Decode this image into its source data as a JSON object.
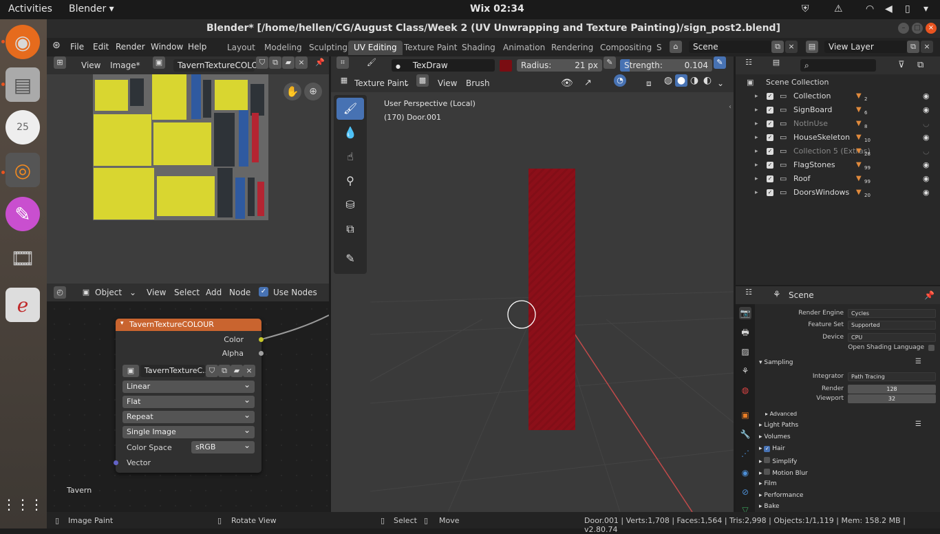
{
  "topbar": {
    "activities": "Activities",
    "app": "Blender ▾",
    "clock": "Wix 02:34"
  },
  "window": {
    "title": "Blender* [/home/hellen/CG/August Class/Week 2 (UV Unwrapping and Texture Painting)/sign_post2.blend]"
  },
  "menu": [
    "File",
    "Edit",
    "Render",
    "Window",
    "Help"
  ],
  "workspaces": [
    "Layout",
    "Modeling",
    "Sculpting",
    "UV Editing",
    "Texture Paint",
    "Shading",
    "Animation",
    "Rendering",
    "Compositing",
    "S"
  ],
  "scene": {
    "name": "Scene",
    "view_layer": "View Layer"
  },
  "image_editor": {
    "view": "View",
    "image": "Image*",
    "image_name": "TavernTextureCOLO..."
  },
  "paint_header": {
    "brush": "TexDraw",
    "radius_label": "Radius:",
    "radius": "21 px",
    "strength_label": "Strength:",
    "strength": "0.104",
    "mode": "Texture Paint",
    "view": "View",
    "brush_menu": "Brush"
  },
  "viewport": {
    "perspective": "User Perspective (Local)",
    "object": "(170) Door.001"
  },
  "node_header": {
    "mode": "Object",
    "view": "View",
    "select": "Select",
    "add": "Add",
    "node": "Node",
    "use_nodes": "Use Nodes"
  },
  "node": {
    "title": "TavernTextureCOLOUR",
    "out_color": "Color",
    "out_alpha": "Alpha",
    "image": "TavernTextureC...",
    "interp": "Linear",
    "proj": "Flat",
    "ext": "Repeat",
    "source": "Single Image",
    "cs_label": "Color Space",
    "cs": "sRGB",
    "vector": "Vector",
    "frame": "Tavern"
  },
  "outliner": {
    "root": "Scene Collection",
    "items": [
      {
        "name": "Collection",
        "dim": false,
        "count": "2"
      },
      {
        "name": "SignBoard",
        "dim": false,
        "count": "6"
      },
      {
        "name": "NotInUse",
        "dim": true,
        "count": "8"
      },
      {
        "name": "HouseSkeleton",
        "dim": false,
        "count": "10"
      },
      {
        "name": "Collection 5 (Extras)",
        "dim": true,
        "count": "28"
      },
      {
        "name": "FlagStones",
        "dim": false,
        "count": "99"
      },
      {
        "name": "Roof",
        "dim": false,
        "count": "99"
      },
      {
        "name": "DoorsWindows",
        "dim": false,
        "count": "20"
      }
    ]
  },
  "properties": {
    "scene": "Scene",
    "render_engine_label": "Render Engine",
    "render_engine": "Cycles",
    "feature_set_label": "Feature Set",
    "feature_set": "Supported",
    "device_label": "Device",
    "device": "CPU",
    "osl": "Open Shading Language",
    "sampling": "Sampling",
    "integrator_label": "Integrator",
    "integrator": "Path Tracing",
    "render_label": "Render",
    "render": "128",
    "viewport_label": "Viewport",
    "viewport": "32",
    "advanced": "Advanced",
    "light_paths": "Light Paths",
    "volumes": "Volumes",
    "hair": "Hair",
    "simplify": "Simplify",
    "motion_blur": "Motion Blur",
    "film": "Film",
    "performance": "Performance",
    "bake": "Bake"
  },
  "status": {
    "image_paint": "Image Paint",
    "rotate": "Rotate View",
    "select": "Select",
    "move": "Move",
    "info": "Door.001 | Verts:1,708 | Faces:1,564 | Tris:2,998 | Objects:1/1,119 | Mem: 158.2 MB | v2.80.74"
  },
  "colors": {
    "accent": "#4772b3",
    "node_header": "#c9642f",
    "paint_color": "#7a0d12"
  }
}
